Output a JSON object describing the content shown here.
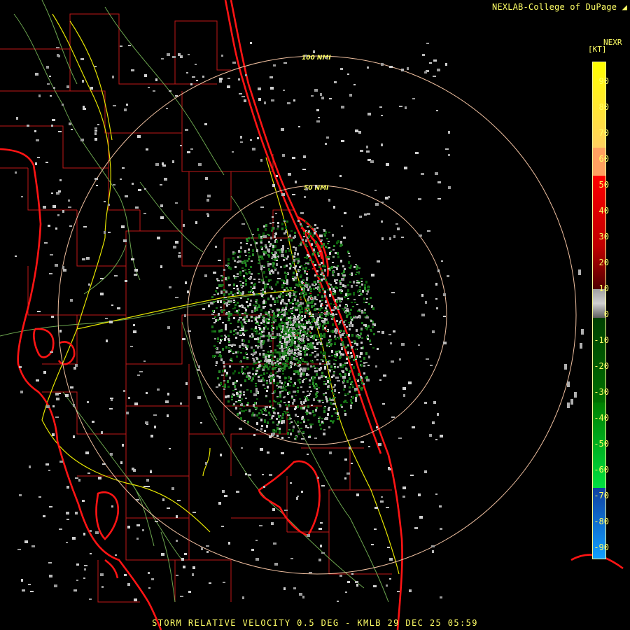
{
  "header": {
    "credit": "NEXLAB-College of DuPage",
    "product_code": "NEXR",
    "unit": "[KT]"
  },
  "legend": {
    "ticks": [
      "90",
      "80",
      "70",
      "60",
      "50",
      "40",
      "30",
      "20",
      "10",
      "0",
      "-10",
      "-20",
      "-30",
      "-40",
      "-50",
      "-60",
      "-70",
      "-80",
      "-90"
    ],
    "colors": {
      "yellow": "#ffff00",
      "orange": "#ffa060",
      "red": "#ff0000",
      "dark_red": "#8b0000",
      "gray": "#a0a0a0",
      "dark_green": "#006400",
      "bright_green": "#00e040",
      "dark_blue": "#1040a0",
      "bright_blue": "#10a0ff"
    }
  },
  "range_rings": {
    "inner_label": "50 NMI",
    "outer_label": "100 NMI"
  },
  "caption": "STORM RELATIVE VELOCITY 0.5 DEG - KMLB 29 DEC 25 05:59",
  "map_colors": {
    "coast": "#ff1010",
    "county": "#cc1818",
    "highway": "#e8e800",
    "road": "#80c060",
    "ring": "#f0c0a0"
  }
}
